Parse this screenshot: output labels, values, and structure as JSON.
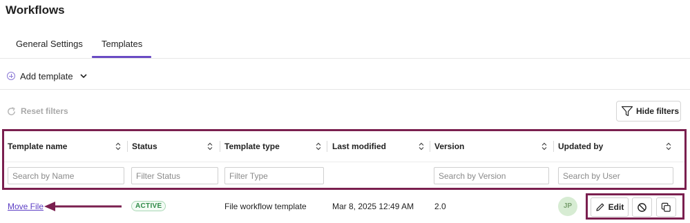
{
  "page": {
    "title": "Workflows"
  },
  "tabs": [
    {
      "label": "General Settings",
      "active": false
    },
    {
      "label": "Templates",
      "active": true
    }
  ],
  "toolbar": {
    "add_template_label": "Add template",
    "reset_filters_label": "Reset filters",
    "hide_filters_label": "Hide filters"
  },
  "table": {
    "columns": [
      {
        "label": "Template name",
        "filter_placeholder": "Search by Name"
      },
      {
        "label": "Status",
        "filter_placeholder": "Filter Status"
      },
      {
        "label": "Template type",
        "filter_placeholder": "Filter Type"
      },
      {
        "label": "Last modified",
        "filter_placeholder": ""
      },
      {
        "label": "Version",
        "filter_placeholder": "Search by Version"
      },
      {
        "label": "Updated by",
        "filter_placeholder": "Search by User"
      }
    ],
    "rows": [
      {
        "name": "Move File",
        "status": "ACTIVE",
        "type": "File workflow template",
        "last_modified": "Mar 8, 2025 12:49 AM",
        "version": "2.0",
        "updated_by_initials": "JP",
        "actions": {
          "edit_label": "Edit"
        }
      }
    ]
  },
  "colors": {
    "accent": "#6a4bc4",
    "highlight_frame": "#7a1f4f",
    "active_badge": "#2e8a47"
  },
  "icons": [
    "plus-circle-icon",
    "chevron-down-icon",
    "refresh-icon",
    "filter-icon",
    "sort-icon",
    "arrow-left-icon",
    "pencil-icon",
    "ban-icon",
    "copy-icon"
  ]
}
